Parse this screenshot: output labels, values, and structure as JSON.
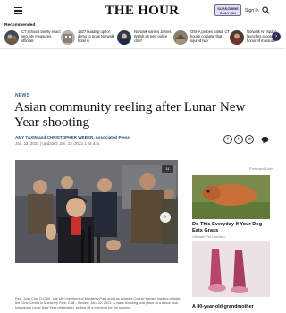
{
  "header": {
    "logo": "THE HOUR",
    "subscribe_line1": "SUBSCRIBE",
    "subscribe_line2": "ONLY $6¢",
    "signin": "Sign In"
  },
  "recommended": {
    "label": "Recommended",
    "items": [
      {
        "text": "CT schools briefly enact security measures, officials"
      },
      {
        "text": "1927 building up for demo to grow Norwalk hotel is"
      },
      {
        "text": "Norwalk names James Walsh as new police chief"
      },
      {
        "text": "OSHA probes partial CT house collapse that injured two"
      },
      {
        "text": "Norwalk Art Space launches program in honor of musician"
      }
    ],
    "next_icon": "chevron-right"
  },
  "article": {
    "section": "NEWS",
    "headline": "Asian community reeling after Lunar New Year shooting",
    "byline": "AMY TAXIN and CHRISTOPHER WEBER, Associated Press",
    "dateline": "Jan. 22, 2023 | Updated: Jan. 23, 2023 1:04 a.m.",
    "share": [
      "f",
      "t",
      "✉"
    ],
    "photo_count": "11",
    "caption": "Rep. Judy Chu, D-Calif., sits with members of Monterey Park and Los Angeles County elected leaders outside the Civic Center in Monterey Park, Calif., Sunday, Jan. 22, 2023. A mass shooting took place at a dance club following a Lunar New Year celebration, setting off a manhunt for the suspect."
  },
  "sidebar": {
    "promoted": "Promoted Links",
    "ad1_title": "Do This Everyday If Your Dog Eats Grass",
    "ad1_source": "Ultimate Pet Nutrition",
    "ad2_title": "A 80-year-old grandmother"
  },
  "colors": {
    "accent": "#1f4b7a",
    "subscribe_bg": "#e3dff2",
    "next_button": "#2a2a5a"
  }
}
